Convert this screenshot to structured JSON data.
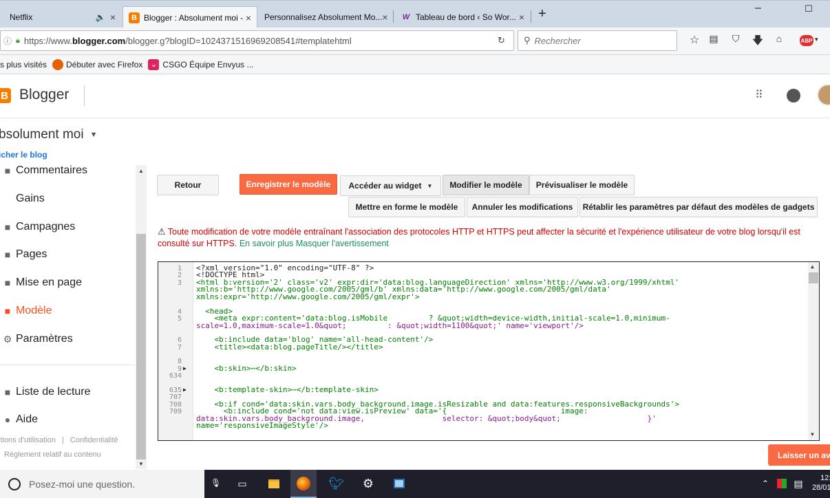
{
  "browser": {
    "tabs": [
      {
        "title": "Netflix",
        "audio": "🔈"
      },
      {
        "title": "Blogger : Absolument moi -"
      },
      {
        "title": "Personnalisez Absolument Mo..."
      },
      {
        "title": "Tableau de bord ‹ So Wor..."
      }
    ],
    "new_tab": "+",
    "tab_close": "×",
    "window_min": "–",
    "window_max": "☐",
    "url_prefix": "https://www.",
    "url_domain": "blogger.com",
    "url_rest": "/blogger.g?blogID=1024371516969208541#templatehtml",
    "search_placeholder": "Rechercher",
    "abp": "ABP",
    "bookmarks": [
      "s plus visités",
      "Débuter avec Firefox",
      "CSGO Équipe Envyus ..."
    ]
  },
  "blogger": {
    "brand": "Blogger",
    "blog_title": "bsolument moi",
    "view_blog": "icher le blog"
  },
  "sidebar": {
    "items": [
      {
        "label": "Commentaires",
        "icon": "comment-icon"
      },
      {
        "label": "Gains",
        "icon": "dollar-icon"
      },
      {
        "label": "Campagnes",
        "icon": "campaign-icon"
      },
      {
        "label": "Pages",
        "icon": "page-icon"
      },
      {
        "label": "Mise en page",
        "icon": "layout-icon"
      },
      {
        "label": "Modèle",
        "icon": "template-icon",
        "active": true
      },
      {
        "label": "Paramètres",
        "icon": "settings-icon"
      },
      {
        "label": "Liste de lecture",
        "icon": "reading-list-icon"
      },
      {
        "label": "Aide",
        "icon": "help-icon"
      }
    ],
    "footer_terms": "itions d'utilisation",
    "footer_sep": "|",
    "footer_privacy": "Confidentialité",
    "footer_content": "Règlement relatif au contenu"
  },
  "toolbar": {
    "back": "Retour",
    "save": "Enregistrer le modèle",
    "widget": "Accéder au widget",
    "edit": "Modifier le modèle",
    "preview": "Prévisualiser le modèle",
    "format": "Mettre en forme le modèle",
    "undo": "Annuler les modifications",
    "reset": "Rétablir les paramètres par défaut des modèles de gadgets"
  },
  "warning": {
    "text": "Toute modification de votre modèle entraînant l'association des protocoles HTTP et HTTPS peut affecter la sécurité et l'expérience utilisateur de votre blog lorsqu'il est consulté sur HTTPS.",
    "learn_more": "En savoir plus",
    "hide": "Masquer l'avertissement"
  },
  "editor": {
    "line_numbers": [
      "1",
      "2",
      "3",
      "4",
      "5",
      "6",
      "7",
      "8",
      "9",
      "634",
      "635",
      "707",
      "708",
      "709"
    ],
    "lines": [
      "<?xml version=\"1.0\" encoding=\"UTF-8\" ?>",
      "<!DOCTYPE html>",
      "<html b:version='2' class='v2' expr:dir='data:blog.languageDirection' xmlns='http://www.w3.org/1999/xhtml'",
      "xmlns:b='http://www.google.com/2005/gml/b' xmlns:data='http://www.google.com/2005/gml/data'",
      "xmlns:expr='http://www.google.com/2005/gml/expr'>",
      "  <head>",
      "    <meta expr:content='data:blog.isMobile         ? &quot;width=device-width,initial-scale=1.0,minimum-",
      "scale=1.0,maximum-scale=1.0&quot;         : &quot;width=1100&quot;' name='viewport'/>",
      "    <b:include data='blog' name='all-head-content'/>",
      "    <title><data:blog.pageTitle/></title>",
      "",
      "    <b:skin>⋯</b:skin>",
      "",
      "    <b:template-skin>⋯</b:template-skin>",
      "",
      "    <b:if cond='data:skin.vars.body_background.image.isResizable and data:features.responsiveBackgrounds'>",
      "      <b:include cond='not data:view.isPreview' data='{                         image:",
      "data:skin.vars.body_background.image,                 selector: &quot;body&quot;                   }'",
      "name='responsiveImageStyle'/>"
    ]
  },
  "feedback": "Laisser un avis",
  "taskbar": {
    "search": "Posez-moi une question.",
    "time": "12:",
    "date": "28/01"
  }
}
